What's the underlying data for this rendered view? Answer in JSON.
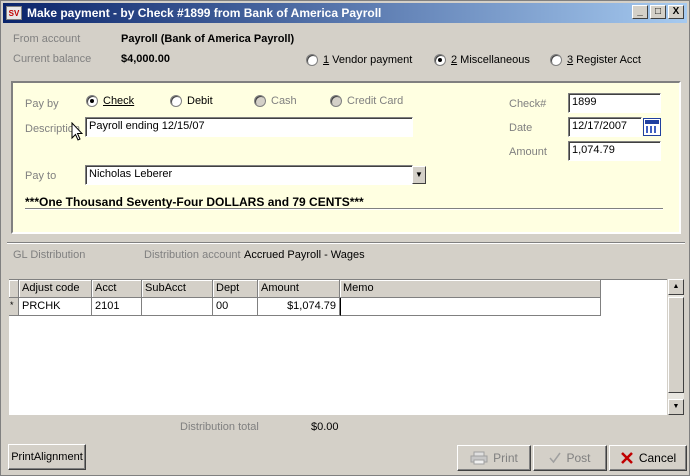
{
  "window": {
    "title": "Make payment - by Check #1899 from Bank of America Payroll",
    "app_icon": "SV",
    "controls": [
      "_",
      "□",
      "X"
    ]
  },
  "header": {
    "from_account_label": "From account",
    "from_account_value": "Payroll (Bank of America Payroll)",
    "current_balance_label": "Current balance",
    "current_balance_value": "$4,000.00",
    "payment_types": [
      {
        "key": "1",
        "label": " Vendor payment",
        "selected": false
      },
      {
        "key": "2",
        "label": " Miscellaneous",
        "selected": true
      },
      {
        "key": "3",
        "label": " Register Acct",
        "selected": false
      }
    ]
  },
  "payment": {
    "pay_by_label": "Pay by",
    "methods": [
      {
        "label": "Check",
        "selected": true,
        "enabled": true
      },
      {
        "label": "Debit",
        "selected": false,
        "enabled": true
      },
      {
        "label": "Cash",
        "selected": false,
        "enabled": false
      },
      {
        "label": "Credit Card",
        "selected": false,
        "enabled": false
      }
    ],
    "description_label": "Description",
    "description_value": "Payroll ending 12/15/07",
    "pay_to_label": "Pay to",
    "pay_to_value": "Nicholas Leberer",
    "amount_words": "***One Thousand Seventy-Four DOLLARS and 79 CENTS***",
    "check_no_label": "Check#",
    "check_no_value": "1899",
    "date_label": "Date",
    "date_value": "12/17/2007",
    "amount_label": "Amount",
    "amount_value": "1,074.79"
  },
  "distribution": {
    "gl_label": "GL Distribution",
    "account_label": "Distribution account",
    "account_value": "Accrued Payroll - Wages",
    "columns": [
      "Adjust code",
      "Acct",
      "SubAcct",
      "Dept",
      "Amount",
      "Memo"
    ],
    "rows": [
      {
        "marker": "*",
        "adjust_code": "PRCHK",
        "acct": "2101",
        "subacct": "",
        "dept": "00",
        "amount": "$1,074.79",
        "memo": ""
      }
    ],
    "total_label": "Distribution total",
    "total_value": "$0.00"
  },
  "buttons": {
    "print_alignment": "PrintAlignment",
    "print": "Print",
    "post": "Post",
    "cancel": "Cancel"
  }
}
